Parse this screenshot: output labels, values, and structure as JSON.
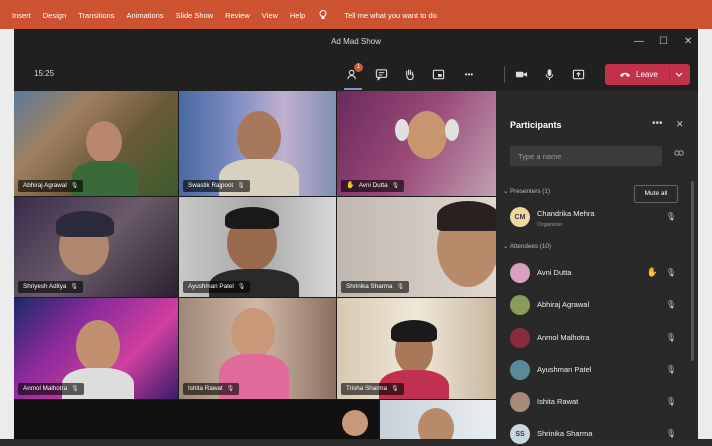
{
  "ribbon": {
    "items": [
      "Insert",
      "Design",
      "Transitions",
      "Animations",
      "Slide Show",
      "Review",
      "View",
      "Help"
    ],
    "tell_me": "Tell me what you want to do"
  },
  "window": {
    "title": "Ad Mad Show",
    "minimize": "—",
    "maximize": "☐",
    "close": "✕"
  },
  "toolbar": {
    "time": "15:25",
    "chat_badge": "1",
    "more": "•••",
    "leave_label": "Leave",
    "icons": [
      "chat-icon",
      "notes-icon",
      "raise-hand-icon",
      "share-icon",
      "camera-icon",
      "mic-icon",
      "share-screen-icon",
      "phone-icon"
    ]
  },
  "tiles": [
    {
      "name": "Abhiraj Agrawal"
    },
    {
      "name": "Swastik Rajpoot"
    },
    {
      "name": "Avni Dutta",
      "hand": "✋"
    },
    {
      "name": "Shriyesh Aditya"
    },
    {
      "name": "Ayushman Patel"
    },
    {
      "name": "Shrinika Sharma"
    },
    {
      "name": "Anmol Malhotra"
    },
    {
      "name": "Ishita Rawat"
    },
    {
      "name": "Trisha Sharma"
    }
  ],
  "participants": {
    "title": "Participants",
    "more": "•••",
    "close": "✕",
    "search_placeholder": "Type a name",
    "presenters_label": "Presenters (1)",
    "mute_all": "Mute all",
    "presenter": {
      "name": "Chandrika Mehra",
      "role": "Organizer",
      "initials": "CM"
    },
    "attendees_label": "Attendees (10)",
    "attendees": [
      {
        "name": "Avni Dutta",
        "hand": "✋"
      },
      {
        "name": "Abhiraj Agrawal"
      },
      {
        "name": "Anmol Malhotra"
      },
      {
        "name": "Ayushman Patel"
      },
      {
        "name": "Ishita Rawat"
      },
      {
        "name": "Shrinika Sharma",
        "initials": "SS"
      }
    ]
  },
  "colors": {
    "ribbon": "#cc5230",
    "leave": "#c4314b",
    "accent": "#8b8cc7",
    "hand": "#f0b93a"
  }
}
